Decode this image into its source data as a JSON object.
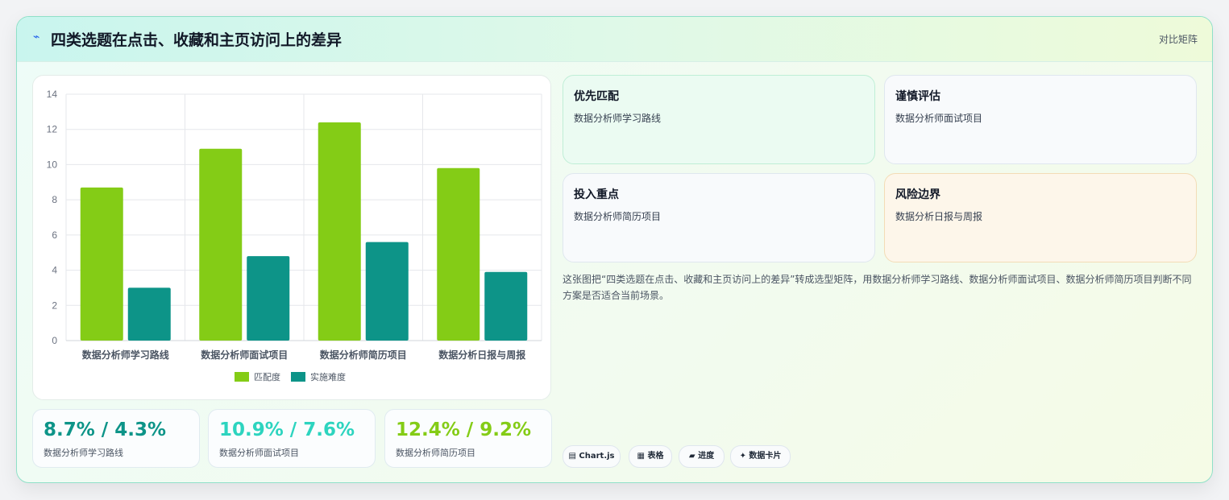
{
  "header": {
    "icon": "⌁",
    "title": "四类选题在点击、收藏和主页访问上的差异",
    "tag": "对比矩阵"
  },
  "chart_data": {
    "type": "bar",
    "categories": [
      "数据分析师学习路线",
      "数据分析师面试项目",
      "数据分析师简历项目",
      "数据分析日报与周报"
    ],
    "series": [
      {
        "name": "匹配度",
        "values": [
          8.7,
          10.9,
          12.4,
          9.8
        ],
        "color": "#84cc16"
      },
      {
        "name": "实施难度",
        "values": [
          3.0,
          4.8,
          5.6,
          3.9
        ],
        "color": "#0d9488"
      }
    ],
    "ylim": [
      0,
      14
    ],
    "yticks": [
      0,
      2,
      4,
      6,
      8,
      10,
      12,
      14
    ],
    "grid": true,
    "legend": "bottom"
  },
  "stats": [
    {
      "value": "8.7% / 4.3%",
      "label": "数据分析师学习路线",
      "color": "#0d9488"
    },
    {
      "value": "10.9% / 7.6%",
      "label": "数据分析师面试项目",
      "color": "#2dd4bf"
    },
    {
      "value": "12.4% / 9.2%",
      "label": "数据分析师简历项目",
      "color": "#84cc16"
    }
  ],
  "quadrants": [
    {
      "title": "优先匹配",
      "desc": "数据分析师学习路线"
    },
    {
      "title": "谨慎评估",
      "desc": "数据分析师面试项目"
    },
    {
      "title": "投入重点",
      "desc": "数据分析师简历项目"
    },
    {
      "title": "风险边界",
      "desc": "数据分析日报与周报"
    }
  ],
  "description": "这张图把“四类选题在点击、收藏和主页访问上的差异”转成选型矩阵，用数据分析师学习路线、数据分析师面试项目、数据分析师简历项目判断不同方案是否适合当前场景。",
  "chips": [
    "▤ Chart.js",
    "▦ 表格",
    "▰ 进度",
    "✦ 数据卡片"
  ]
}
